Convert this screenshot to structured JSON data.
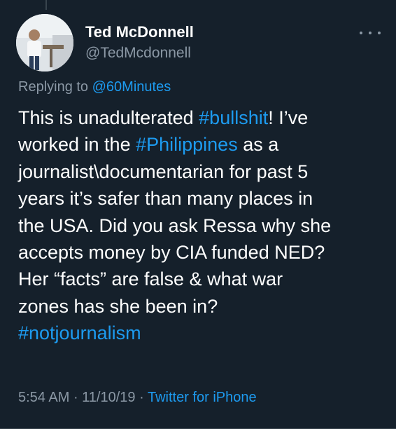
{
  "author": {
    "display_name": "Ted McDonnell",
    "handle": "@TedMcdonnell"
  },
  "reply": {
    "prefix": "Replying to",
    "mention": "@60Minutes"
  },
  "tweet": {
    "line1_a": "This is unadulterated ",
    "hashtag_bullshit": "#bullshit",
    "line1_b": "! I’ve",
    "line2_a": "worked in the ",
    "hashtag_philippines": "#Philippines",
    "line2_b": " as a",
    "line3": "journalist\\documentarian for past 5",
    "line4": "years it’s safer than many places in",
    "line5": "the USA. Did you ask Ressa why she",
    "line6": "accepts money by CIA funded NED?",
    "line7": "Her “facts” are false & what war",
    "line8": "zones has she been in?",
    "hashtag_notjournalism": "#notjournalism"
  },
  "meta": {
    "time": "5:54 AM",
    "separator": " · ",
    "date": "11/10/19",
    "source": "Twitter for iPhone"
  },
  "colors": {
    "background": "#15202b",
    "accent": "#1d9bf0",
    "secondary_text": "#8b98a5"
  },
  "icons": {
    "more": "more-options-icon"
  }
}
